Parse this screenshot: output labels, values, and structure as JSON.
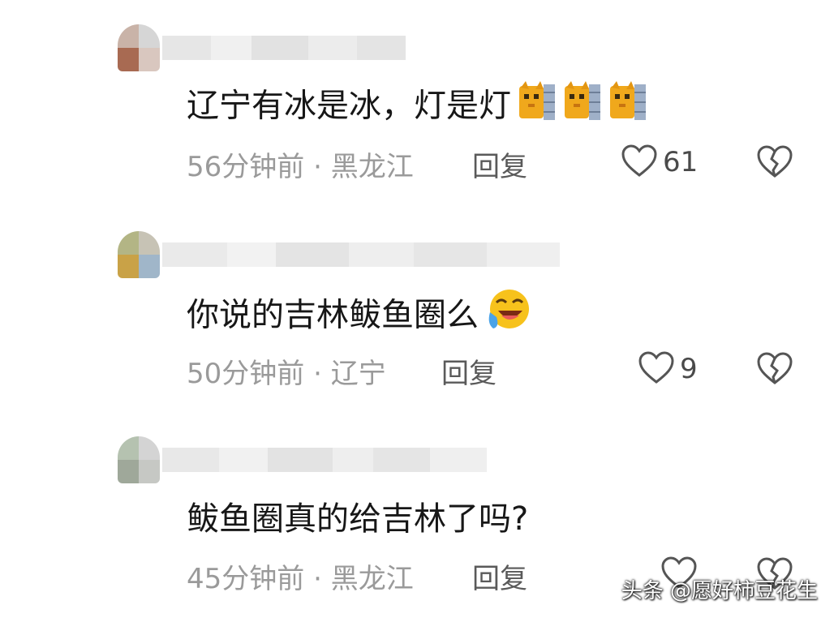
{
  "comments": [
    {
      "text": "辽宁有冰是冰，灯是灯",
      "emojis": [
        "cat-face-icon",
        "cat-face-icon",
        "cat-face-icon"
      ],
      "time": "56分钟前",
      "separator": "·",
      "location": "黑龙江",
      "reply_label": "回复",
      "likes": "61"
    },
    {
      "text": "你说的吉林鲅鱼圈么",
      "emojis": [
        "laughing-crying-icon"
      ],
      "time": "50分钟前",
      "separator": "·",
      "location": "辽宁",
      "reply_label": "回复",
      "likes": "9"
    },
    {
      "text": "鲅鱼圈真的给吉林了吗?",
      "emojis": [],
      "time": "45分钟前",
      "separator": "·",
      "location": "黑龙江",
      "reply_label": "回复",
      "likes": ""
    }
  ],
  "watermark": "头条 @愿好柿豆花生",
  "colors": {
    "text": "#171717",
    "meta": "#9a9a9a",
    "icon": "#555555"
  }
}
